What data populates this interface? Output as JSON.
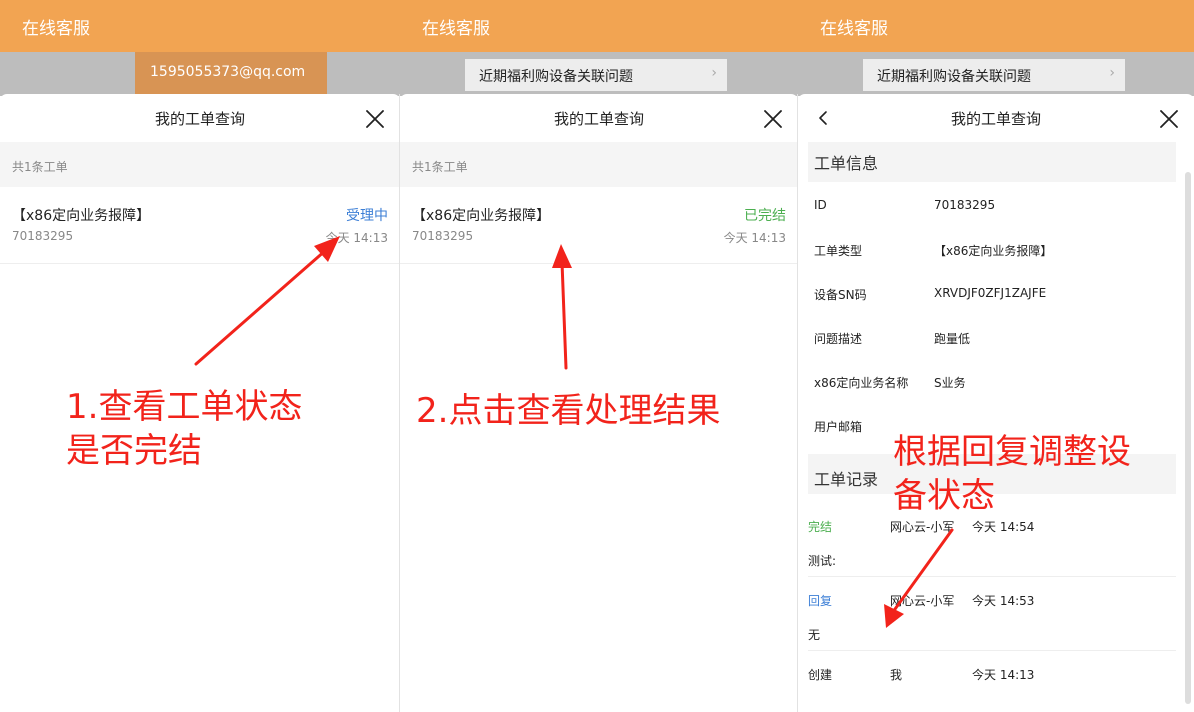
{
  "app_title": "在线客服",
  "bg": {
    "email": "1595055373@qq.com",
    "notice": "近期福利购设备关联问题",
    "chevron": "›"
  },
  "sheet": {
    "title": "我的工单查询",
    "close_icon": "close-icon",
    "back_icon": "chevron-left-icon"
  },
  "list": {
    "count": "共1条工单",
    "ticket": {
      "name": "【x86定向业务报障】",
      "id": "70183295",
      "time": "今天 14:13"
    },
    "status_processing": "受理中",
    "status_done": "已完结"
  },
  "detail": {
    "info_header": "工单信息",
    "fields": [
      {
        "label": "ID",
        "value": "70183295"
      },
      {
        "label": "工单类型",
        "value": "【x86定向业务报障】"
      },
      {
        "label": "设备SN码",
        "value": "XRVDJF0ZFJ1ZAJFE"
      },
      {
        "label": "问题描述",
        "value": "跑量低"
      },
      {
        "label": "x86定向业务名称",
        "value": "S业务"
      },
      {
        "label": "用户邮箱",
        "value": ""
      }
    ],
    "records_header": "工单记录",
    "records": [
      {
        "action": "完结",
        "who": "网心云-小军",
        "time": "今天 14:54",
        "text": "测试:"
      },
      {
        "action": "回复",
        "who": "网心云-小军",
        "time": "今天 14:53",
        "text": "无"
      },
      {
        "action": "创建",
        "who": "我",
        "time": "今天 14:13",
        "text": ""
      }
    ]
  },
  "annotations": {
    "note1": "1.查看工单状态\n是否完结",
    "note2": "2.点击查看处理结果",
    "note3": "根据回复调整设\n备状态"
  },
  "colors": {
    "header_orange": "#f2a452",
    "status_blue": "#3d7fd6",
    "status_green": "#4caf50",
    "action_green": "#4caf50",
    "action_blue": "#3d7fd6",
    "annotation_red": "#f2231b"
  }
}
